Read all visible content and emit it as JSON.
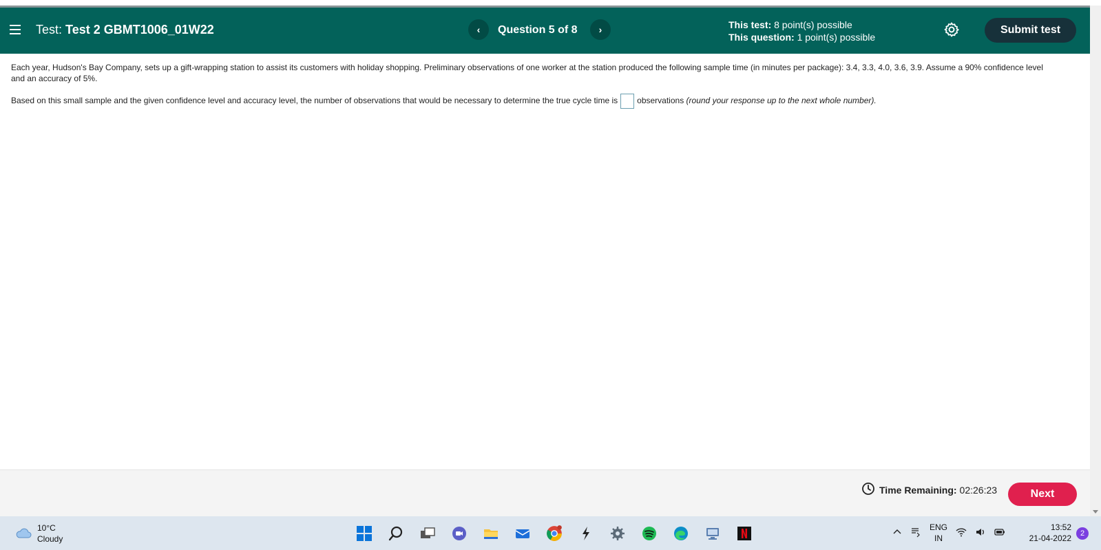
{
  "header": {
    "test_label": "Test:",
    "test_name": "Test 2 GBMT1006_01W22",
    "prev_glyph": "‹",
    "next_glyph": "›",
    "question_label": "Question 5 of 8",
    "this_test_label": "This test:",
    "this_test_value": "8 point(s) possible",
    "this_question_label": "This question:",
    "this_question_value": "1 point(s) possible",
    "submit_label": "Submit test",
    "colors": {
      "bar": "#03625a",
      "submit": "#17313a"
    }
  },
  "question": {
    "paragraph1": "Each year, Hudson's Bay Company, sets up a gift-wrapping station to assist its customers with holiday shopping. Preliminary observations of one worker at the station produced the following sample time (in minutes per package): 3.4, 3.3, 4.0, 3.6, 3.9. Assume a 90% confidence level and an accuracy of 5%.",
    "paragraph2_before": "Based on this small sample and the given confidence level and accuracy level, the number of observations that would be necessary to determine the true cycle time is",
    "answer_value": "",
    "paragraph2_after": "observations",
    "hint": "(round your response up to the next whole number)."
  },
  "footer": {
    "time_label": "Time Remaining:",
    "time_value": "02:26:23",
    "next_label": "Next",
    "colors": {
      "next": "#e0204e"
    }
  },
  "taskbar": {
    "temperature": "10°C",
    "condition": "Cloudy",
    "lang_top": "ENG",
    "lang_bottom": "IN",
    "time": "13:52",
    "date": "21-04-2022",
    "notification_count": "2",
    "icons": [
      "windows-start-icon",
      "search-icon",
      "task-view-icon",
      "teams-chat-icon",
      "file-explorer-icon",
      "mail-icon",
      "chrome-icon",
      "app-bolt-icon",
      "settings-icon",
      "spotify-icon",
      "edge-icon",
      "network-app-icon",
      "netflix-icon"
    ]
  }
}
